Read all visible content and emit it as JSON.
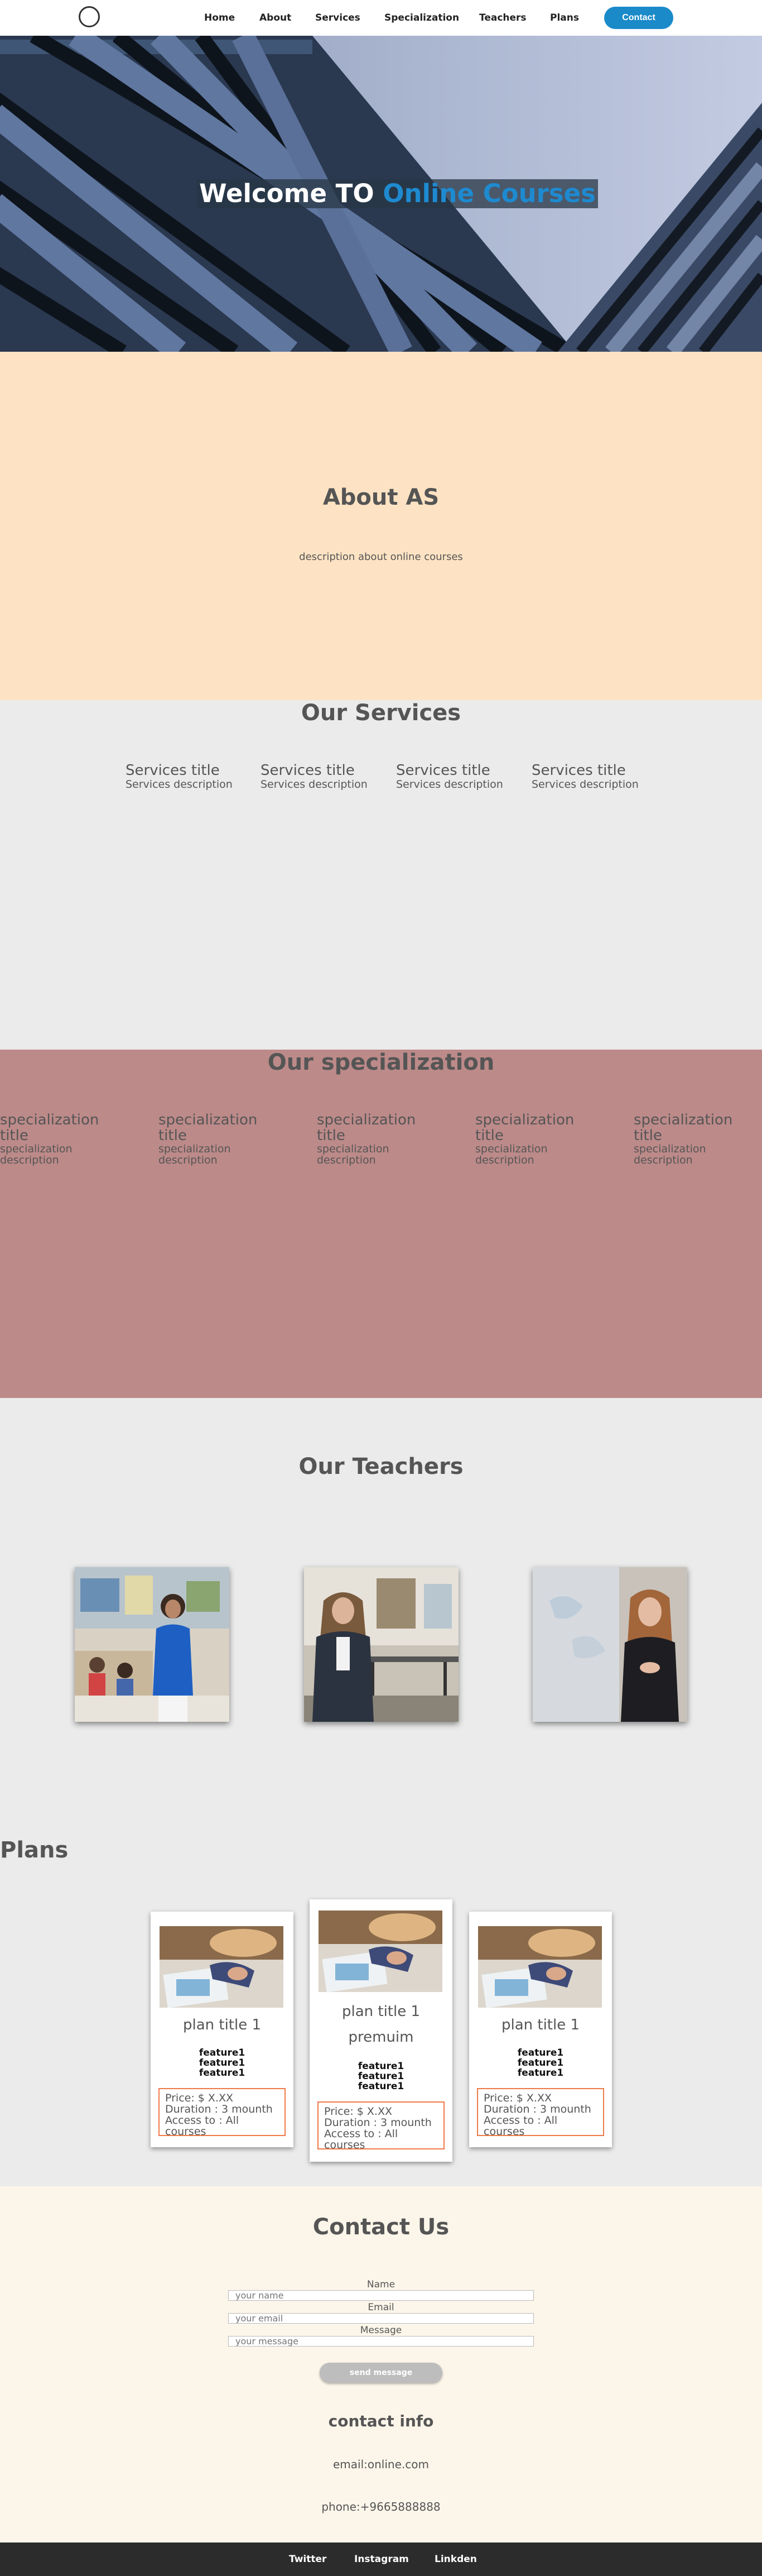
{
  "nav": {
    "items": [
      "Home",
      "About",
      "Services",
      "Specialization",
      "Teachers",
      "Plans"
    ],
    "contact_label": "Contact"
  },
  "hero": {
    "title_prefix": "Welcome TO",
    "title_highlight": "Online Courses"
  },
  "about": {
    "title": "About AS",
    "description": "description about online courses"
  },
  "services": {
    "title": "Our Services",
    "items": [
      {
        "title": "Services title",
        "description": "Services description"
      },
      {
        "title": "Services title",
        "description": "Services description"
      },
      {
        "title": "Services title",
        "description": "Services description"
      },
      {
        "title": "Services title",
        "description": "Services description"
      }
    ]
  },
  "specialization": {
    "title": "Our specialization",
    "items": [
      {
        "title": "specialization title",
        "description": "specialization description"
      },
      {
        "title": "specialization title",
        "description": "specialization description"
      },
      {
        "title": "specialization title",
        "description": "specialization description"
      },
      {
        "title": "specialization title",
        "description": "specialization description"
      },
      {
        "title": "specialization title",
        "description": "specialization description"
      }
    ]
  },
  "teachers": {
    "title": "Our Teachers"
  },
  "plans": {
    "title": "Plans",
    "items": [
      {
        "title": "plan title 1",
        "subtitle": "",
        "features": [
          "feature1",
          "feature1",
          "feature1"
        ],
        "price": "Price: $ X.XX",
        "duration": "Duration : 3 mounth",
        "access": "Access to : All courses"
      },
      {
        "title": "plan title 1",
        "subtitle": "premuim",
        "features": [
          "feature1",
          "feature1",
          "feature1"
        ],
        "price": "Price: $ X.XX",
        "duration": "Duration : 3 mounth",
        "access": "Access to : All courses"
      },
      {
        "title": "plan title 1",
        "subtitle": "",
        "features": [
          "feature1",
          "feature1",
          "feature1"
        ],
        "price": "Price: $ X.XX",
        "duration": "Duration : 3 mounth",
        "access": "Access to : All courses"
      }
    ]
  },
  "contact": {
    "title": "Contact Us",
    "name_label": "Name",
    "name_placeholder": "your name",
    "email_label": "Email",
    "email_placeholder": "your email",
    "message_label": "Message",
    "message_placeholder": "your message",
    "send_label": "send message",
    "info_title": "contact info",
    "email": "email:online.com",
    "phone": "phone:+9665888888"
  },
  "footer": {
    "links": [
      "Twitter",
      "Instagram",
      "Linkden"
    ]
  },
  "colors": {
    "accent": "#1a8ac9",
    "about_bg": "#fde3c3",
    "spec_bg": "#bc8a89",
    "plan_border": "#f07a48",
    "footer_bg": "#2c2c2c"
  }
}
